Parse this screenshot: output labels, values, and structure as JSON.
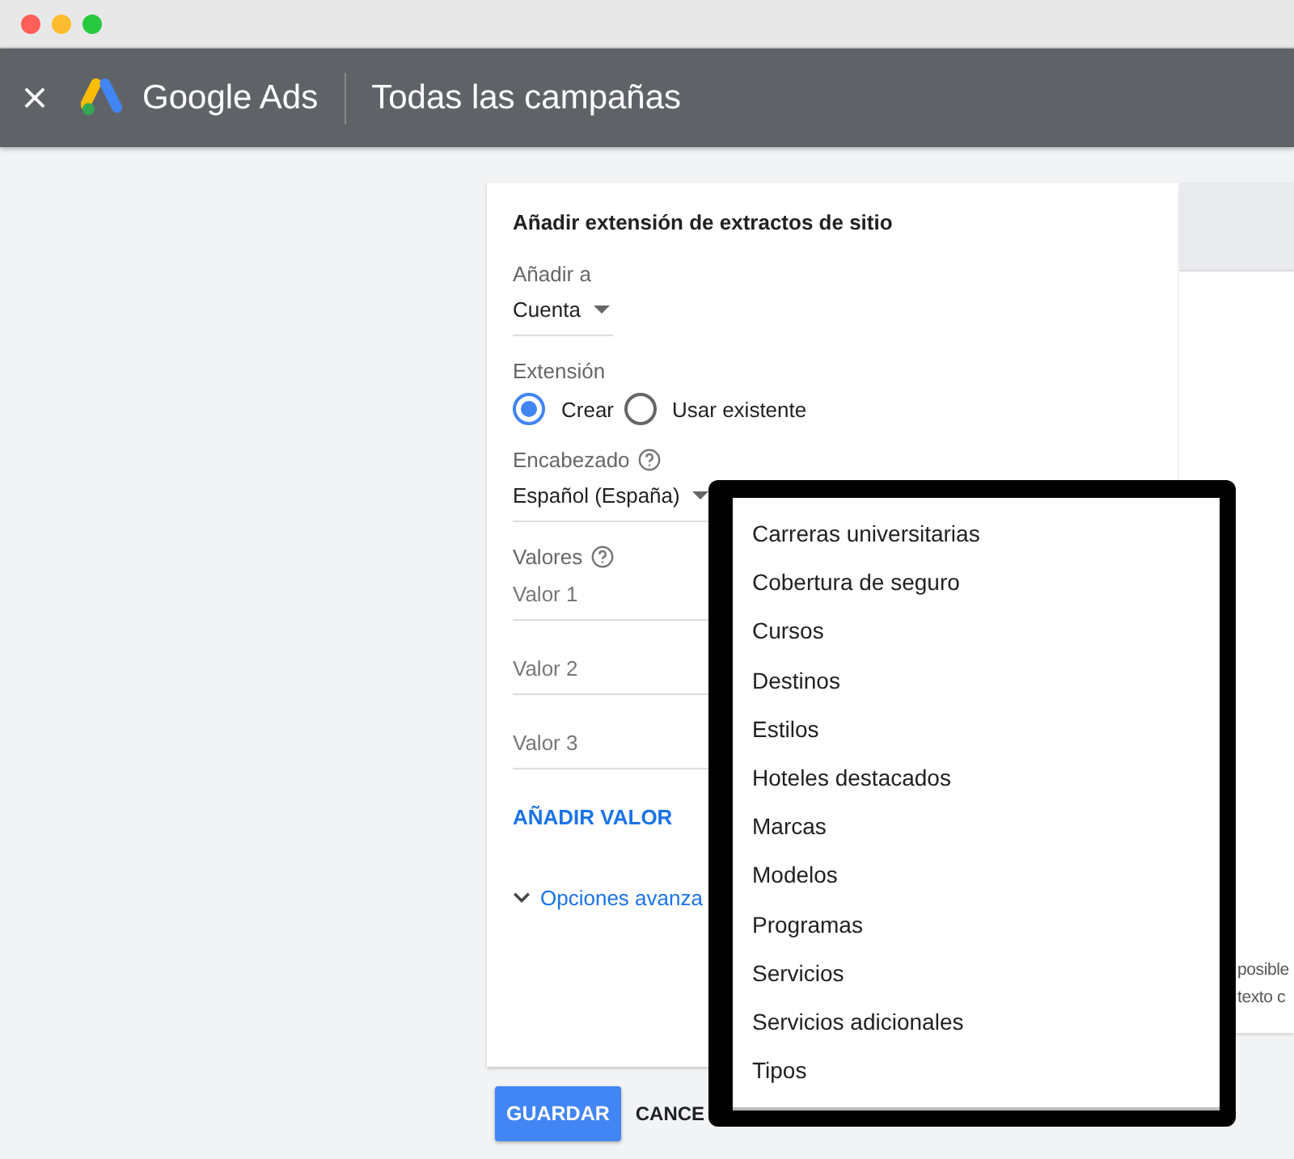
{
  "header": {
    "product": "Google Ads",
    "title": "Todas las campañas"
  },
  "dialog": {
    "title": "Añadir extensión de extractos de sitio",
    "add_to": {
      "label": "Añadir a",
      "value": "Cuenta"
    },
    "extension": {
      "label": "Extensión",
      "options": [
        {
          "label": "Crear",
          "selected": true
        },
        {
          "label": "Usar existente",
          "selected": false
        }
      ]
    },
    "heading": {
      "label": "Encabezado",
      "value": "Español (España)"
    },
    "values": {
      "label": "Valores",
      "fields": [
        {
          "placeholder": "Valor 1"
        },
        {
          "placeholder": "Valor 2"
        },
        {
          "placeholder": "Valor 3"
        }
      ]
    },
    "add_value": "AÑADIR VALOR",
    "advanced": "Opciones avanza",
    "buttons": {
      "save": "GUARDAR",
      "cancel": "CANCE"
    }
  },
  "side_panel": {
    "lines": [
      "posible",
      "texto c"
    ]
  },
  "dropdown": {
    "items": [
      "Carreras universitarias",
      "Cobertura de seguro",
      "Cursos",
      "Destinos",
      "Estilos",
      "Hoteles destacados",
      "Marcas",
      "Modelos",
      "Programas",
      "Servicios",
      "Servicios adicionales",
      "Tipos"
    ]
  }
}
